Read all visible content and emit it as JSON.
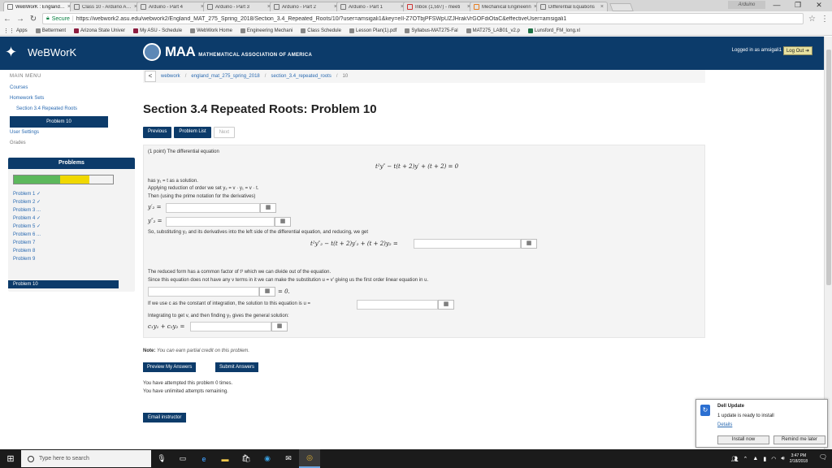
{
  "browser": {
    "tabs": [
      {
        "title": "WeBWorK : England_M"
      },
      {
        "title": "Class 10 - Arduino Assi"
      },
      {
        "title": "Arduino - Part 4"
      },
      {
        "title": "Arduino - Part 3"
      },
      {
        "title": "Arduino - Part 2"
      },
      {
        "title": "Arduino - Part 1"
      },
      {
        "title": "Inbox (1,597) - meeti"
      },
      {
        "title": "Mechanical Engineerin"
      },
      {
        "title": "Differential Equations"
      }
    ],
    "profile": "Arduino",
    "window_controls": {
      "minimize": "—",
      "maximize": "❐",
      "close": "✕"
    },
    "secure_label": "Secure",
    "url": "https://webwork2.asu.edu/webwork2/England_MAT_275_Spring_2018/Section_3.4_Repeated_Roots/10/?user=amsigali1&key=eII-Z7OTbjPFSWpUZJHrakVrGOFdiOtaC&effectiveUser=amsigali1",
    "bookmarks": [
      "Apps",
      "Betterment",
      "Arizona State Univer",
      "My ASU - Schedule",
      "WebWork Home",
      "Engineering Mechani",
      "Class Schedule",
      "Lesson Plan(1).pdf",
      "Syllabus-MAT275-Fal",
      "MAT275_LAB01_v2.p",
      "Lunsford_FM_long.xl"
    ]
  },
  "header": {
    "app_name": "WeBWorK",
    "maa_big": "MAA",
    "maa_small": "MATHEMATICAL ASSOCIATION OF AMERICA",
    "logged_in": "Logged in as amsigali1",
    "logout_label": "Log Out"
  },
  "sidebar": {
    "main_menu": "MAIN MENU",
    "courses": "Courses",
    "homework_sets": "Homework Sets",
    "section": "Section 3.4 Repeated Roots",
    "problem": "Problem 10",
    "user_settings": "User Settings",
    "grades": "Grades",
    "problems_title": "Problems",
    "progress": {
      "correct_fraction": 0.47,
      "partial_fraction": 0.29
    },
    "problem_list": [
      "Problem 1 ✓",
      "Problem 2 ✓",
      "Problem 3 ...",
      "Problem 4 ✓",
      "Problem 5 ✓",
      "Problem 6 ...",
      "Problem 7",
      "Problem 8",
      "Problem 9",
      "Problem 10"
    ]
  },
  "breadcrumb": {
    "back": "<",
    "items": [
      "webwork",
      "england_mat_275_spring_2018",
      "section_3.4_repeated_roots"
    ],
    "current": "10",
    "sep": "/"
  },
  "main": {
    "title": "Section 3.4 Repeated Roots: Problem 10",
    "prev_label": "Previous",
    "list_label": "Problem List",
    "next_label": "Next"
  },
  "problem": {
    "intro": "(1 point) The differential equation",
    "equation": "t²y″ − t(t + 2)y′ + (t + 2) = 0",
    "has_solution": "has y₁ = t as a solution.",
    "applying": "Applying reduction of order we set y₂ = v · y₁ = v · t.",
    "then": "Then (using the prime notation for the derivatives)",
    "y2p": "y′₂ =",
    "y2pp": "y″₂ =",
    "substituting": "So, substituting y₂ and its derivatives into the left side of the differential equation, and reducing, we get",
    "reduced_eq": "t²y″₂ − t(t + 2)y′₂ + (t + 2)y₂ =",
    "reduced_form": "The reduced form has a common factor of t³ which we can divide out of the equation.",
    "since": "Since this equation does not have any v terms in it we can make the substitution u = v′ giving us the first order linear equation in u.",
    "eq_zero": "= 0.",
    "if_we_use": "If we use c as the constant of integration, the solution to this equation is u =",
    "integrating": "Integrating to get v, and then finding y₂ gives the general solution:",
    "general": "c₁y₁ + c₂y₂ =",
    "matrix_icon": "▦"
  },
  "footer": {
    "note_bold": "Note:",
    "note_italic": "You can earn partial credit on this problem.",
    "preview_label": "Preview My Answers",
    "submit_label": "Submit Answers",
    "attempted": "You have attempted this problem 0 times.",
    "unlimited": "You have unlimited attempts remaining.",
    "email_label": "Email instructor"
  },
  "dell": {
    "title": "Dell Update",
    "message": "1 update is ready to install",
    "details": "Details",
    "install": "Install now",
    "remind": "Remind me later"
  },
  "taskbar": {
    "search_placeholder": "Type here to search",
    "time": "3:47 PM",
    "date": "2/18/2018"
  }
}
